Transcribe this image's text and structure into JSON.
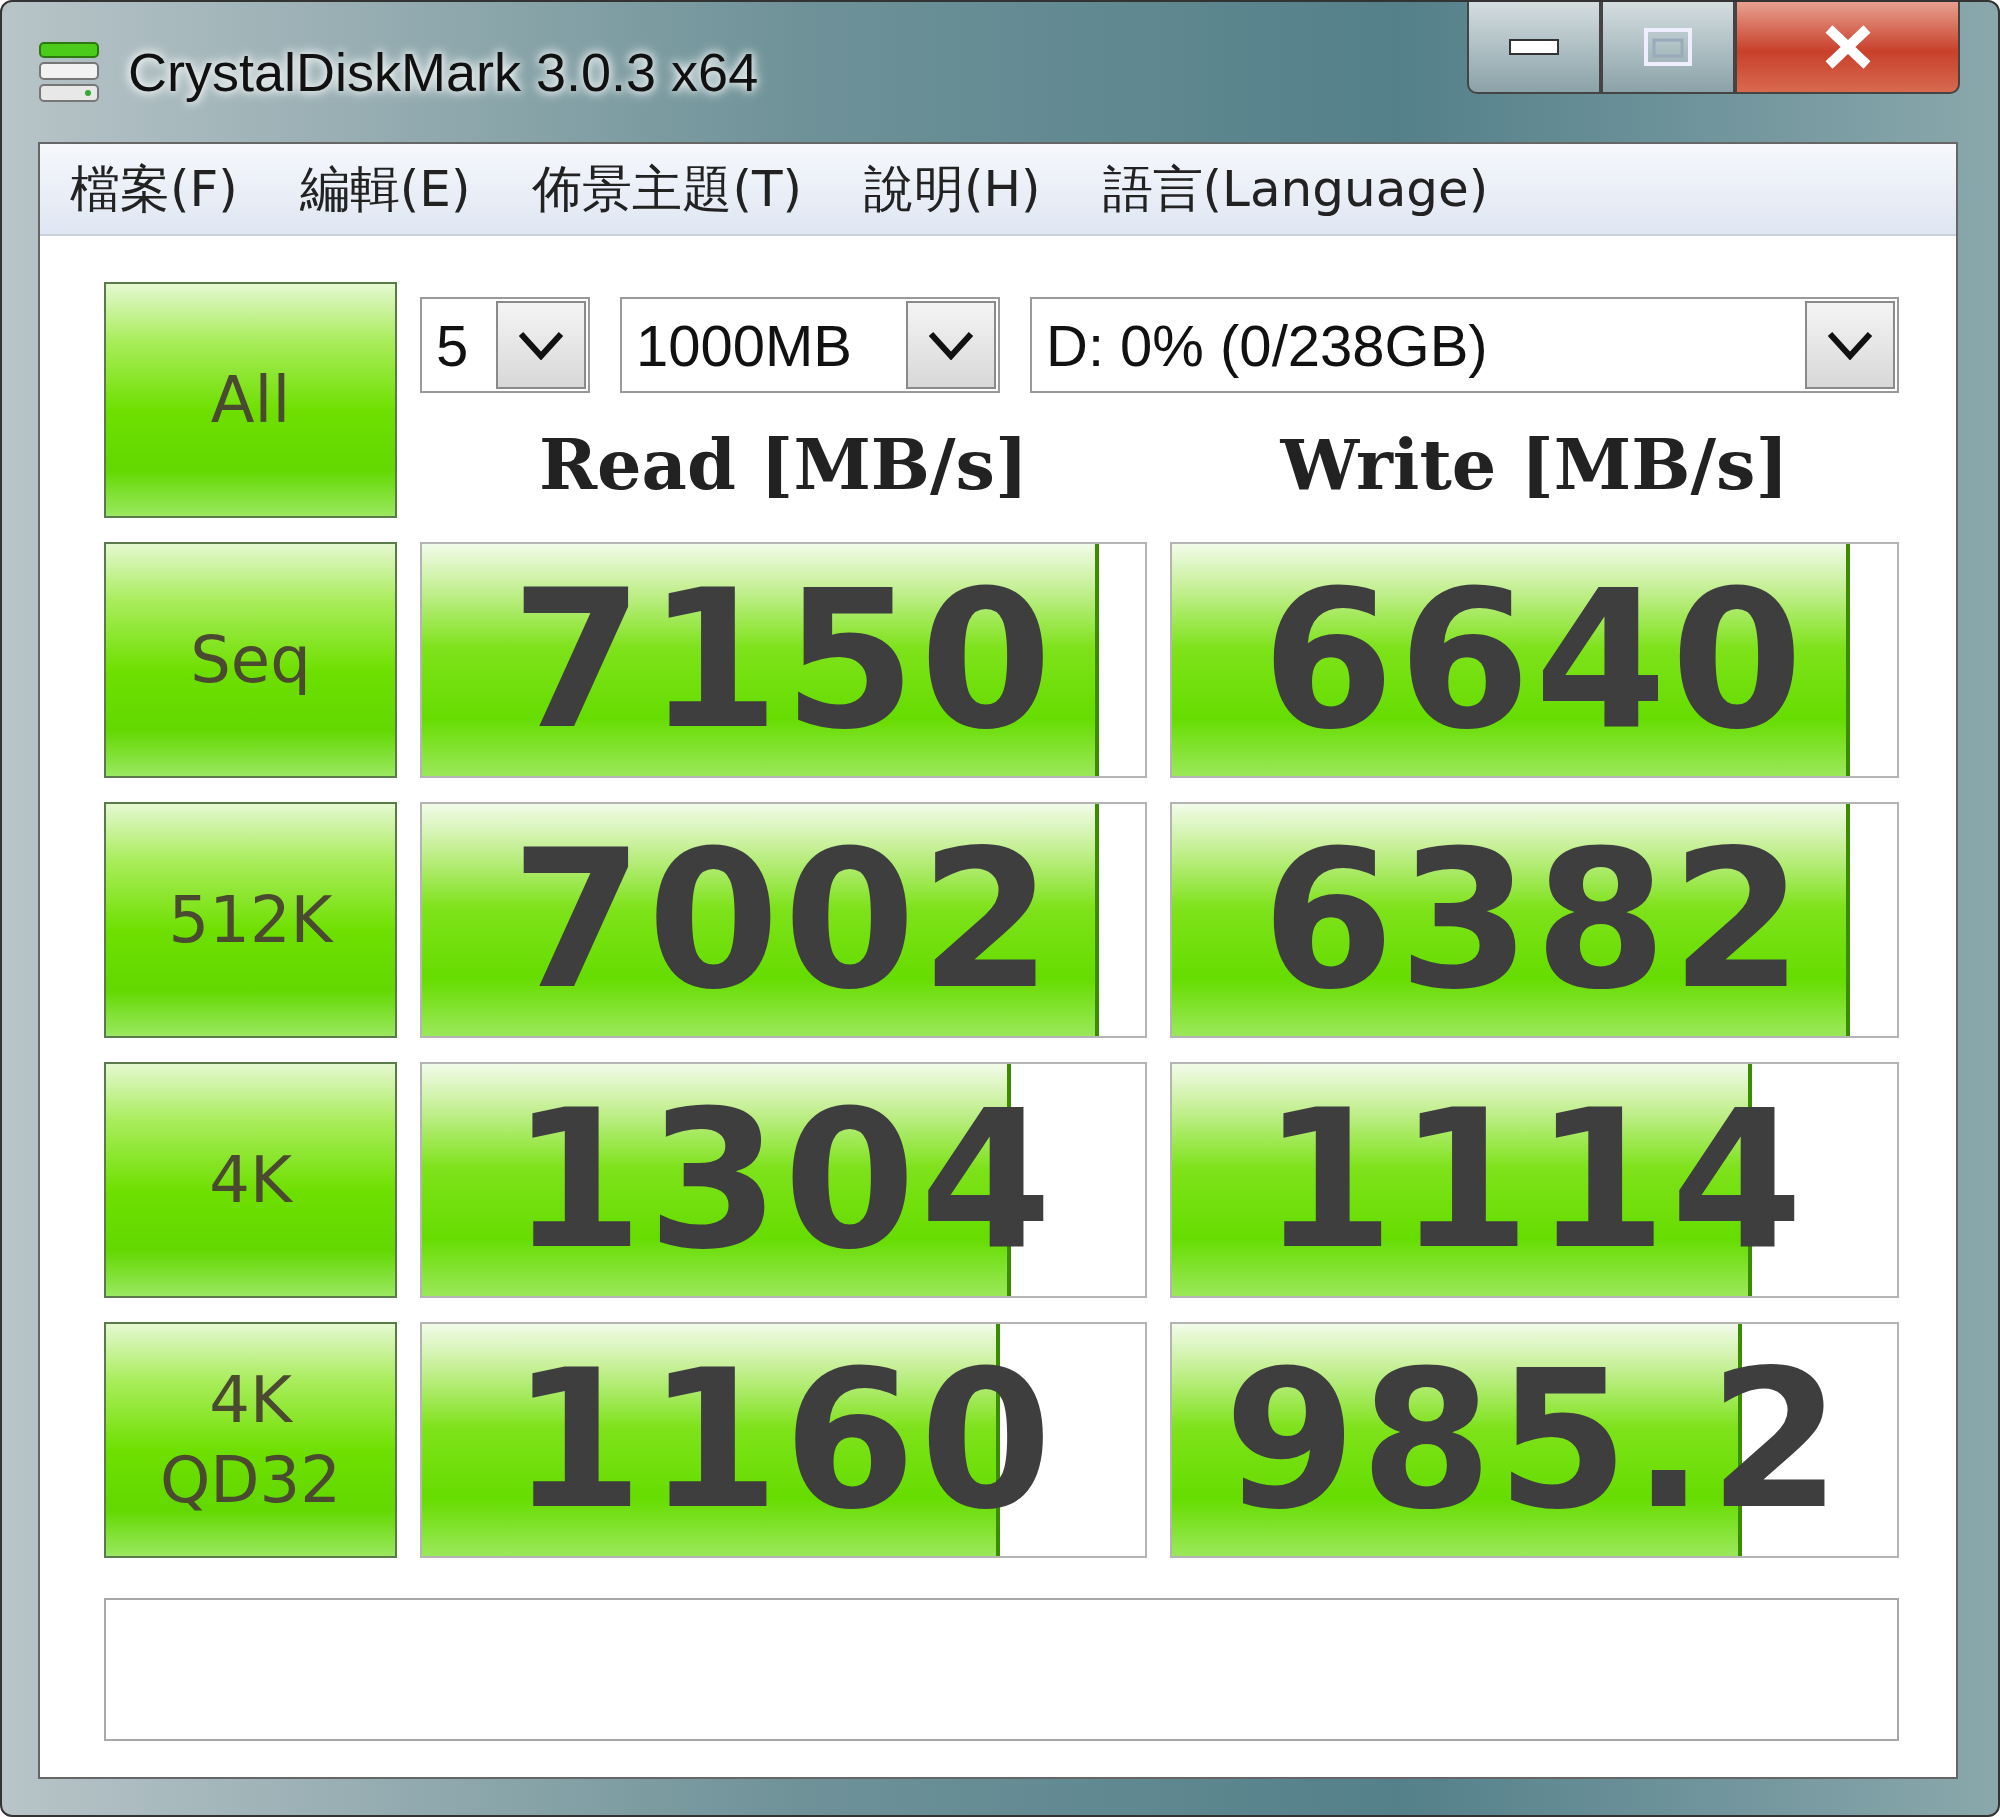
{
  "window": {
    "title": "CrystalDiskMark 3.0.3 x64"
  },
  "menu": [
    "檔案(F)",
    "編輯(E)",
    "佈景主題(T)",
    "說明(H)",
    "語言(Language)"
  ],
  "controls": {
    "all_button": "All",
    "test_count": "5",
    "test_size": "1000MB",
    "drive": "D: 0% (0/238GB)"
  },
  "headers": {
    "read": "Read [MB/s]",
    "write": "Write [MB/s]"
  },
  "rows": [
    {
      "label": [
        "Seq"
      ],
      "read": {
        "value": "7150",
        "level": 0.937
      },
      "write": {
        "value": "6640",
        "level": 0.935
      }
    },
    {
      "label": [
        "512K"
      ],
      "read": {
        "value": "7002",
        "level": 0.937
      },
      "write": {
        "value": "6382",
        "level": 0.935
      }
    },
    {
      "label": [
        "4K"
      ],
      "read": {
        "value": "1304",
        "level": 0.814
      },
      "write": {
        "value": "1114",
        "level": 0.8
      }
    },
    {
      "label": [
        "4K",
        "QD32"
      ],
      "read": {
        "value": "1160",
        "level": 0.8
      },
      "write": {
        "value": "985.2",
        "level": 0.786
      }
    }
  ]
}
